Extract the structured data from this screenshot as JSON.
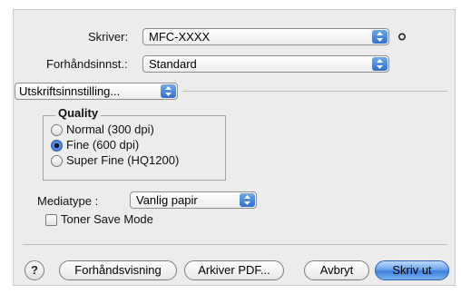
{
  "printer": {
    "label": "Skriver:",
    "value": "MFC-XXXX"
  },
  "presets": {
    "label": "Forhåndsinnst.:",
    "value": "Standard"
  },
  "panel_select": {
    "value": "Utskriftsinnstilling..."
  },
  "quality": {
    "title": "Quality",
    "options": [
      "Normal (300 dpi)",
      "Fine (600 dpi)",
      "Super Fine (HQ1200)"
    ],
    "selected": "Fine (600 dpi)"
  },
  "media": {
    "label": "Mediatype :",
    "value": "Vanlig papir"
  },
  "toner_save": {
    "label": "Toner Save Mode",
    "checked": false
  },
  "buttons": {
    "help": "?",
    "preview": "Forhåndsvisning",
    "save_pdf": "Arkiver PDF...",
    "cancel": "Avbryt",
    "print": "Skriv ut"
  },
  "colors": {
    "accent": "#3e7fdc"
  },
  "icons": {
    "popup": "up-down-arrows-icon",
    "lock": "lock-icon",
    "radio_selected": "radio-dot-icon"
  }
}
